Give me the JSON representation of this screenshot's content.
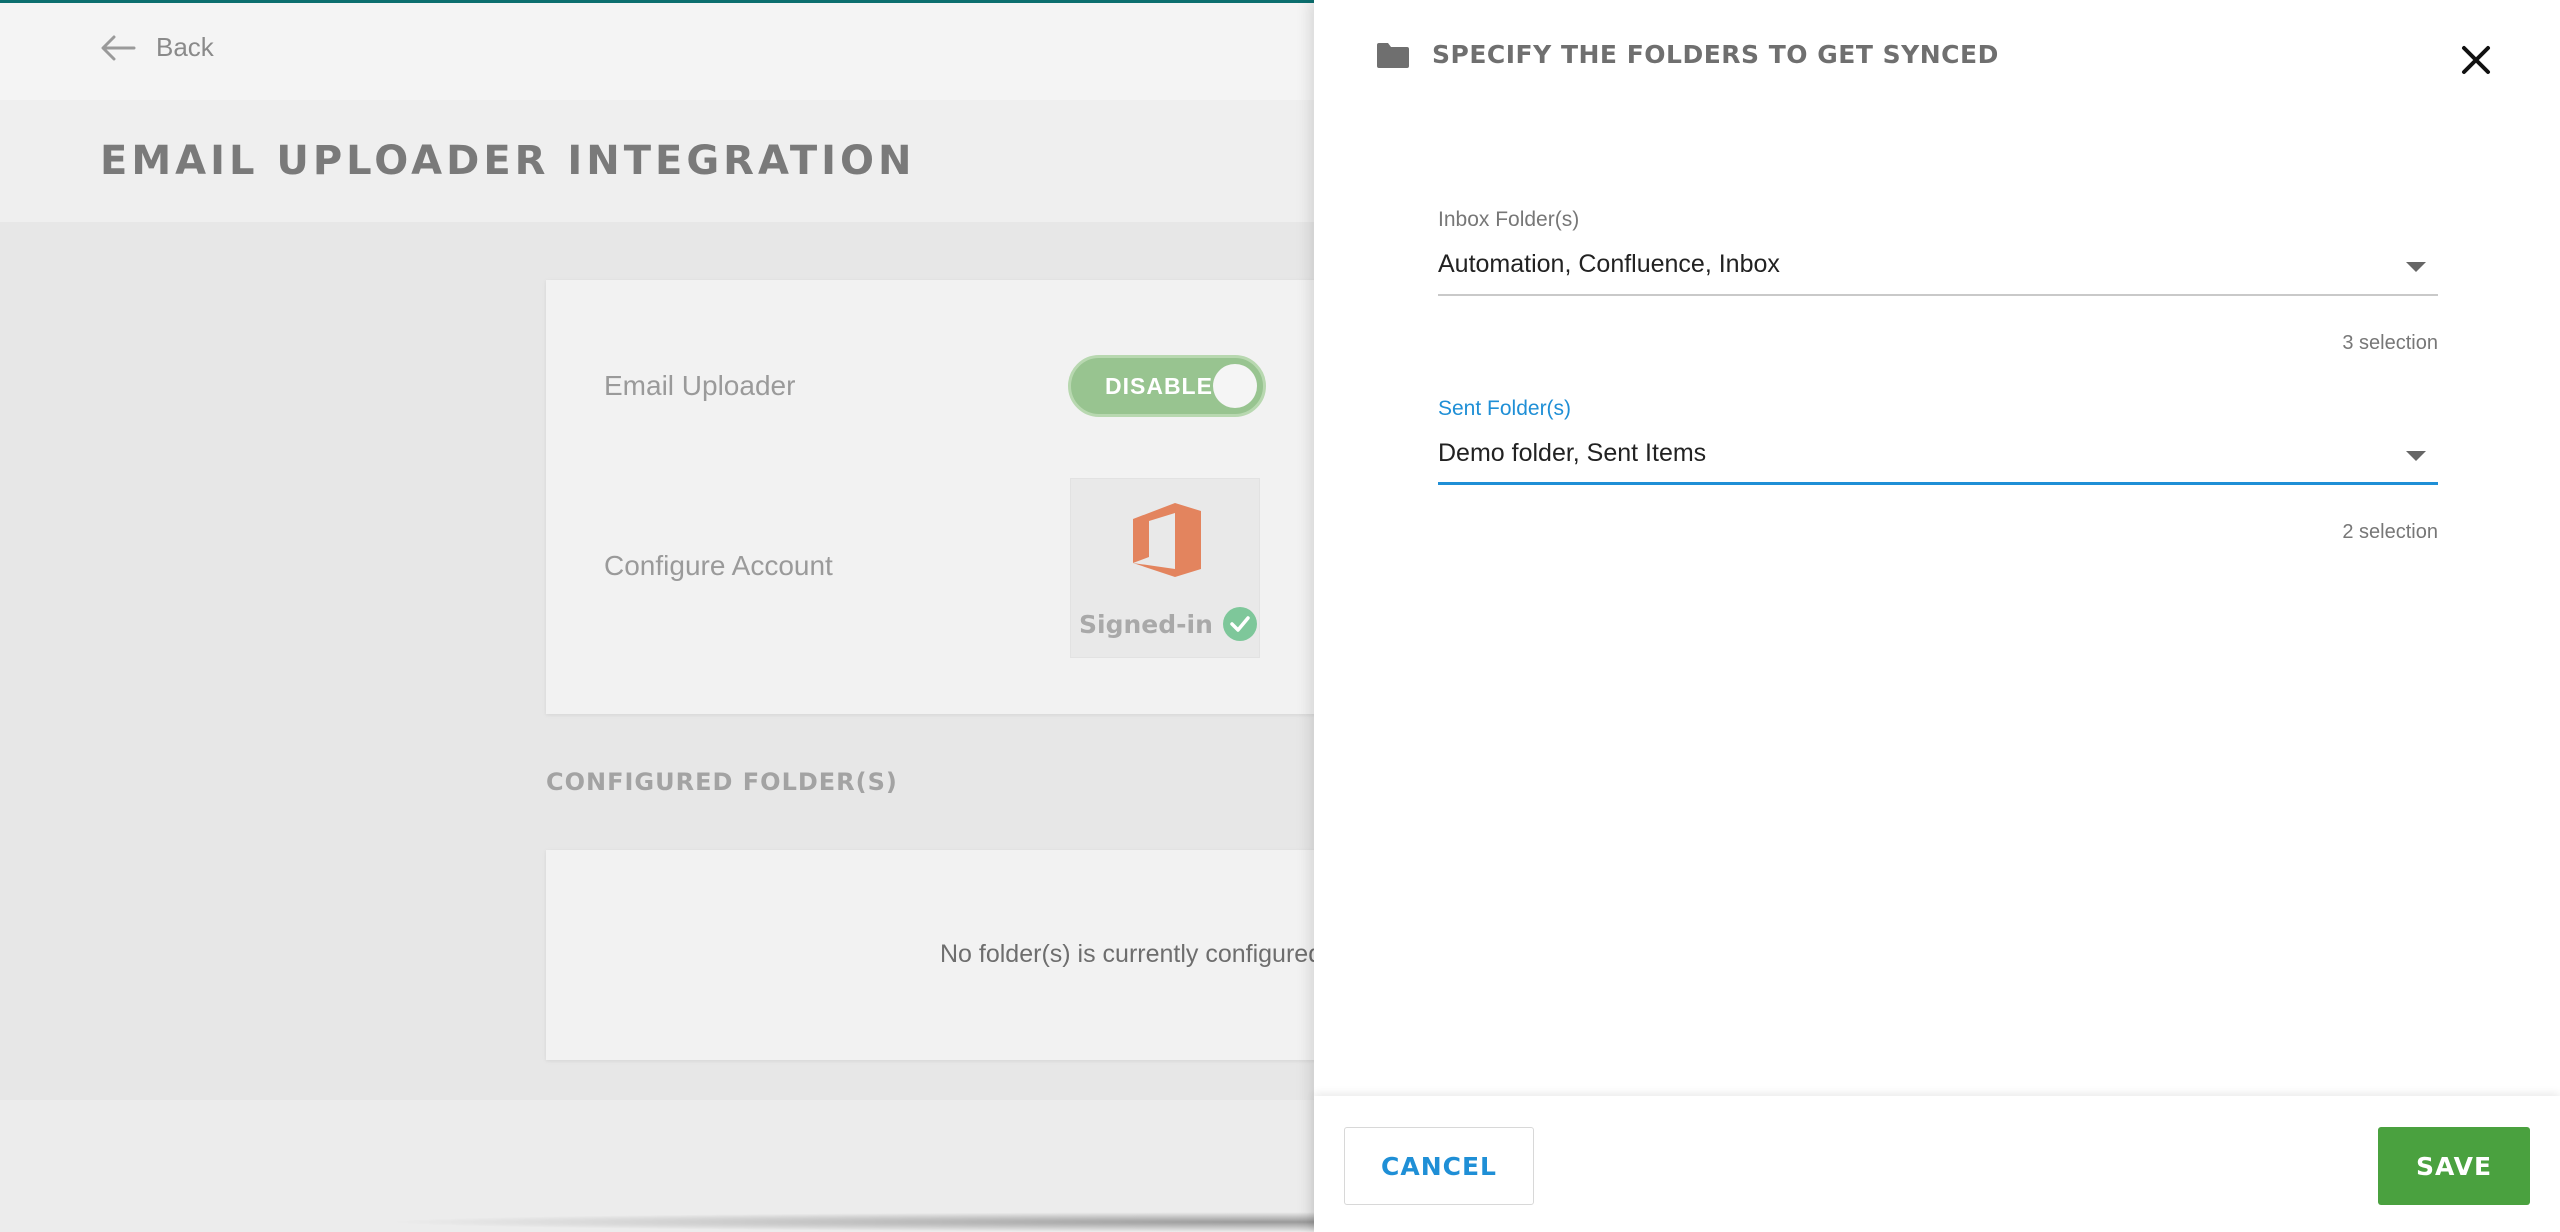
{
  "background": {
    "back_label": "Back",
    "page_title": "EMAIL UPLOADER INTEGRATION",
    "email_uploader_label": "Email Uploader",
    "toggle_label": "DISABLE",
    "configure_account_label": "Configure Account",
    "signed_in_label": "Signed-in",
    "configured_folders_title": "CONFIGURED FOLDER(S)",
    "empty_message": "No folder(s) is currently configured. I"
  },
  "drawer": {
    "title": "SPECIFY THE FOLDERS TO GET SYNCED",
    "inbox": {
      "label": "Inbox Folder(s)",
      "value": "Automation, Confluence, Inbox",
      "count": "3 selection"
    },
    "sent": {
      "label": "Sent Folder(s)",
      "value": "Demo folder, Sent Items",
      "count": "2 selection"
    },
    "cancel_label": "CANCEL",
    "save_label": "SAVE"
  },
  "icons": {
    "back": "arrow-left-icon",
    "folder": "folder-icon",
    "close": "close-icon",
    "office": "office-logo-icon",
    "check": "check-circle-icon",
    "dropdown": "caret-down-icon"
  },
  "colors": {
    "accent_blue": "#1f8fd6",
    "save_green": "#4aa13f",
    "toggle_green": "#98c490",
    "office_orange": "#e3845e",
    "check_green": "#7ec79a"
  }
}
